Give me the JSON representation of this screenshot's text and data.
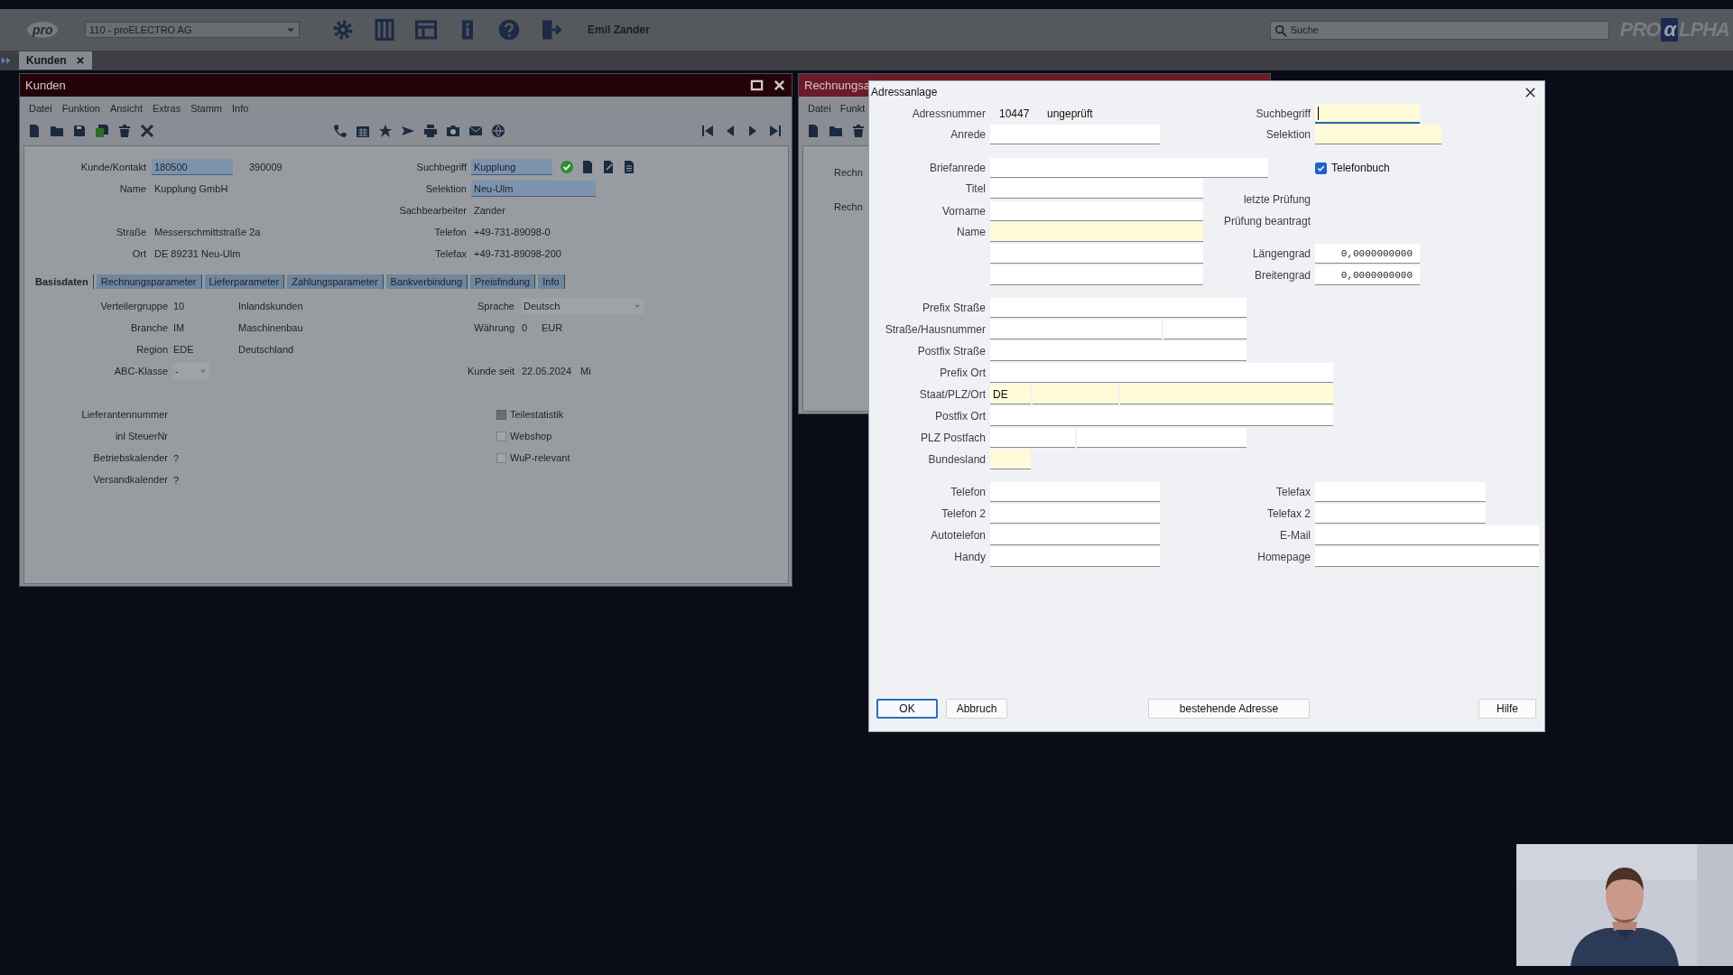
{
  "top_bar": {
    "logo": "pro",
    "company": "110 - proELECTRO AG",
    "user": "Emil Zander",
    "search": {
      "placeholder": "Suche"
    },
    "brand": {
      "lead": "PRO",
      "mark": "α",
      "tail": "LPHA"
    }
  },
  "open_tabs": [
    {
      "label": "Kunden",
      "selected": true
    }
  ],
  "customer_window": {
    "title": "Kunden",
    "menu": [
      "Datei",
      "Funktion",
      "Ansicht",
      "Extras",
      "Stamm",
      "Info"
    ],
    "header_left": [
      {
        "label": "Kunde/Kontakt",
        "value": "180500",
        "highlighted": true,
        "extra": "390009"
      },
      {
        "label": "Name",
        "value": "Kupplung GmbH",
        "highlighted": false
      },
      {
        "label": "Straße",
        "value": "Messerschmittstraße 2a",
        "highlighted": false
      },
      {
        "label": "Ort",
        "value": "DE 89231 Neu-Ulm",
        "highlighted": false
      }
    ],
    "header_right": [
      {
        "label": "Suchbegriff",
        "value": "Kupplung",
        "highlighted": true
      },
      {
        "label": "Selektion",
        "value": "Neu-Ulm",
        "highlighted": true
      },
      {
        "label": "Sachbearbeiter",
        "value": "Zander",
        "highlighted": false
      },
      {
        "label": "Telefon",
        "value": "+49-731-89098-0",
        "highlighted": false
      },
      {
        "label": "Telefax",
        "value": "+49-731-89098-200",
        "highlighted": false
      }
    ],
    "tabs": [
      {
        "label": "Basisdaten",
        "selected": true
      },
      {
        "label": "Rechnungsparameter",
        "selected": false
      },
      {
        "label": "Lieferparameter",
        "selected": false
      },
      {
        "label": "Zahlungsparameter",
        "selected": false
      },
      {
        "label": "Bankverbindung",
        "selected": false
      },
      {
        "label": "Preisfindung",
        "selected": false
      },
      {
        "label": "Info",
        "selected": false
      }
    ],
    "basic_left": [
      {
        "label": "Verteilergruppe",
        "code": "10",
        "description": "Inlandskunden",
        "kind": "lookup"
      },
      {
        "label": "Branche",
        "code": "IM",
        "description": "Maschinenbau",
        "kind": "lookup"
      },
      {
        "label": "Region",
        "code": "EDE",
        "description": "Deutschland",
        "kind": "lookup"
      },
      {
        "label": "ABC-Klasse",
        "code": "-",
        "kind": "dropdown"
      }
    ],
    "basic_right": [
      {
        "label": "Sprache",
        "code": "Deutsch",
        "kind": "dropdown"
      },
      {
        "label": "Währung",
        "code": "0",
        "description": "EUR",
        "kind": "lookup"
      },
      {
        "label": "Kunde seit",
        "code": "22.05.2024",
        "description": "Mi",
        "kind": "lookup"
      }
    ],
    "extra_fields": [
      {
        "label": "Lieferantennummer"
      },
      {
        "label": "inl SteuerNr"
      },
      {
        "label": "Betriebskalender",
        "value": "?"
      },
      {
        "label": "Versandkalender",
        "value": "?"
      }
    ],
    "options": [
      {
        "label": "Teilestatistik",
        "disabled": true
      },
      {
        "label": "Webshop",
        "disabled": false
      },
      {
        "label": "WuP-relevant",
        "disabled": false
      }
    ]
  },
  "invoice_window": {
    "title": "Rechnungsa",
    "menu": [
      "Datei",
      "Funkt"
    ],
    "labels": [
      "Rechn",
      "Rechn"
    ]
  },
  "address_dialog": {
    "title": "Adressanlage",
    "number": {
      "label": "Adressnummer",
      "value": "10447",
      "status": "ungeprüft"
    },
    "name_fields": [
      {
        "label": "Anrede",
        "required": false
      },
      {
        "label": "Briefanrede",
        "required": false
      },
      {
        "label": "Titel",
        "required": false
      },
      {
        "label": "Vorname",
        "required": false
      },
      {
        "label": "Name",
        "required": true
      },
      {
        "required": false
      },
      {
        "required": false
      }
    ],
    "side": [
      {
        "kind": "field",
        "label": "Suchbegriff",
        "required": true,
        "focused": true
      },
      {
        "kind": "field",
        "label": "Selektion",
        "required": true,
        "focused": false
      },
      {
        "kind": "checkbox",
        "label": "Telefonbuch",
        "checked": true
      },
      {
        "kind": "info",
        "label": "letzte Prüfung"
      },
      {
        "kind": "info",
        "label": "Prüfung beantragt"
      },
      {
        "kind": "number",
        "label": "Längengrad",
        "value": "0,0000000000"
      },
      {
        "kind": "number",
        "label": "Breitengrad",
        "value": "0,0000000000"
      }
    ],
    "address": [
      {
        "label": "Prefix Straße",
        "inputs": [
          {
            "required": false
          }
        ]
      },
      {
        "label": "Straße/Hausnummer",
        "inputs": [
          {
            "required": false
          },
          {
            "required": false
          }
        ]
      },
      {
        "label": "Postfix Straße",
        "inputs": [
          {
            "required": false
          }
        ]
      },
      {
        "label": "Prefix Ort",
        "inputs": [
          {
            "required": false
          }
        ]
      },
      {
        "label": "Staat/PLZ/Ort",
        "inputs": [
          {
            "required": true,
            "value": "DE"
          },
          {
            "required": true
          },
          {
            "required": true
          }
        ]
      },
      {
        "label": "Postfix Ort",
        "inputs": [
          {
            "required": false
          }
        ]
      },
      {
        "label": "PLZ Postfach",
        "inputs": [
          {
            "required": false
          },
          {
            "required": false
          }
        ]
      },
      {
        "label": "Bundesland",
        "inputs": [
          {
            "required": true
          }
        ]
      }
    ],
    "contact_left": [
      {
        "label": "Telefon"
      },
      {
        "label": "Telefon 2"
      },
      {
        "label": "Autotelefon"
      },
      {
        "label": "Handy"
      }
    ],
    "contact_right": [
      {
        "label": "Telefax"
      },
      {
        "label": "Telefax 2"
      },
      {
        "label": "E-Mail"
      },
      {
        "label": "Homepage"
      }
    ],
    "buttons": [
      {
        "label": "OK",
        "default": true
      },
      {
        "label": "Abbruch",
        "default": false
      },
      {
        "label": "bestehende Adresse",
        "default": false
      },
      {
        "label": "Hilfe",
        "default": false
      }
    ]
  }
}
